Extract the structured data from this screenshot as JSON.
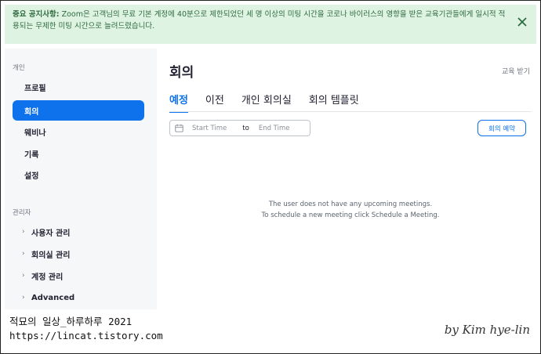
{
  "notice": {
    "label": "중요 공지사항:",
    "text": " Zoom은 고객님의 무료 기본 계정에 40분으로 제한되었던 세 명 이상의 미팅 시간을 코로나 바이러스의 영향을 받은 교육기관들에게 일시적 적용되는 무제한 미팅 시간으로 늘려드렸습니다."
  },
  "sidebar": {
    "personal_heading": "개인",
    "personal_items": [
      {
        "label": "프로필"
      },
      {
        "label": "회의"
      },
      {
        "label": "웨비나"
      },
      {
        "label": "기록"
      },
      {
        "label": "설정"
      }
    ],
    "admin_heading": "관리자",
    "admin_items": [
      {
        "label": "사용자 관리"
      },
      {
        "label": "회의실 관리"
      },
      {
        "label": "계정 관리"
      },
      {
        "label": "Advanced"
      }
    ]
  },
  "main": {
    "title": "회의",
    "edu_link": "교육 받기",
    "tabs": [
      {
        "label": "예정"
      },
      {
        "label": "이전"
      },
      {
        "label": "개인 회의실"
      },
      {
        "label": "회의 템플릿"
      }
    ],
    "date_range": {
      "start_placeholder": "Start Time",
      "separator": "to",
      "end_placeholder": "End Time"
    },
    "schedule_button": "회의 예약",
    "empty_line1": "The user does not have any upcoming meetings.",
    "empty_line2": "To schedule a new meeting click Schedule a Meeting."
  },
  "watermark": {
    "line1": "적묘의 일상_하루하루 2021",
    "line2": "https://lincat.tistory.com",
    "signature": "by Kim hye-lin"
  },
  "colors": {
    "accent": "#0e72ed",
    "notice_bg": "#dff3e3",
    "notice_text": "#2e6b3f",
    "sidebar_bg": "#f6f7f9"
  }
}
